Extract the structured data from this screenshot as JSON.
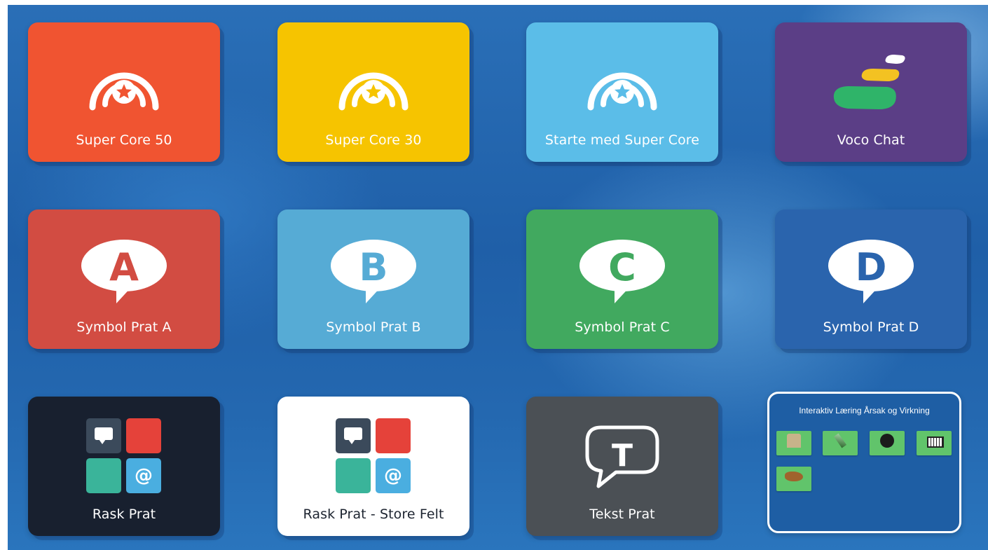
{
  "colors": {
    "super_core_50": "#f05431",
    "super_core_30": "#f6c400",
    "starte": "#5bbde8",
    "voco_chat": "#5b3e86",
    "symbol_a": "#d24c42",
    "symbol_b": "#56abd5",
    "symbol_c": "#41a95f",
    "symbol_d": "#2a64ad",
    "rask_prat": "#18202f",
    "rask_prat_store": "#ffffff",
    "tekst_prat": "#4b5055"
  },
  "tiles": {
    "super_core_50": {
      "label": "Super Core 50",
      "icon": "rainbow-star-icon"
    },
    "super_core_30": {
      "label": "Super Core 30",
      "icon": "rainbow-star-icon"
    },
    "starte": {
      "label": "Starte med Super Core",
      "icon": "rainbow-star-icon"
    },
    "voco_chat": {
      "label": "Voco Chat",
      "icon": "voco-chat-logo-icon"
    },
    "symbol_a": {
      "label": "Symbol Prat A",
      "letter": "A",
      "icon": "speech-bubble-icon"
    },
    "symbol_b": {
      "label": "Symbol Prat B",
      "letter": "B",
      "icon": "speech-bubble-icon"
    },
    "symbol_c": {
      "label": "Symbol Prat C",
      "letter": "C",
      "icon": "speech-bubble-icon"
    },
    "symbol_d": {
      "label": "Symbol Prat D",
      "letter": "D",
      "icon": "speech-bubble-icon"
    },
    "rask_prat": {
      "label": "Rask Prat",
      "icon": "mosaic-grid-icon",
      "at": "@"
    },
    "rask_prat_store": {
      "label": "Rask Prat - Store Felt",
      "icon": "mosaic-grid-icon",
      "at": "@"
    },
    "tekst_prat": {
      "label": "Tekst Prat",
      "letter": "T",
      "icon": "text-bubble-icon"
    }
  },
  "learning": {
    "title": "Interaktiv Læring Årsak og Virkning",
    "items": [
      {
        "icon": "house-icon"
      },
      {
        "icon": "rocket-icon"
      },
      {
        "icon": "disco-ball-icon"
      },
      {
        "icon": "piano-icon"
      },
      {
        "icon": "animal-icon"
      }
    ]
  }
}
